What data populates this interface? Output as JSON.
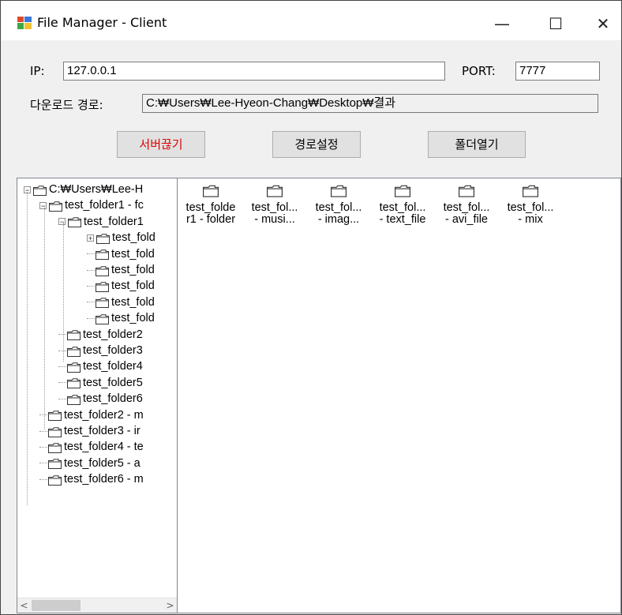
{
  "window": {
    "title": "File Manager - Client",
    "min_glyph": "—",
    "max_glyph": "☐",
    "close_glyph": "✕"
  },
  "connection": {
    "ip_label": "IP:",
    "ip_value": "127.0.0.1",
    "port_label": "PORT:",
    "port_value": "7777",
    "path_label": "다운로드 경로:",
    "path_value": "C:₩Users₩Lee-Hyeon-Chang₩Desktop₩결과"
  },
  "buttons": {
    "disconnect": "서버끊기",
    "set_path": "경로설정",
    "open_folder": "폴더열기"
  },
  "tree": [
    {
      "label": "C:₩Users₩Lee-H",
      "depth": 0,
      "exp": "⊟"
    },
    {
      "label": "test_folder1 - fc",
      "depth": 1,
      "exp": "⊟"
    },
    {
      "label": "test_folder1",
      "depth": 2,
      "exp": "⊟"
    },
    {
      "label": "test_fold",
      "depth": 3,
      "exp": "⊞"
    },
    {
      "label": "test_fold",
      "depth": 3
    },
    {
      "label": "test_fold",
      "depth": 3
    },
    {
      "label": "test_fold",
      "depth": 3
    },
    {
      "label": "test_fold",
      "depth": 3
    },
    {
      "label": "test_fold",
      "depth": 3
    },
    {
      "label": "test_folder2",
      "depth": 2
    },
    {
      "label": "test_folder3",
      "depth": 2
    },
    {
      "label": "test_folder4",
      "depth": 2
    },
    {
      "label": "test_folder5",
      "depth": 2
    },
    {
      "label": "test_folder6",
      "depth": 2
    },
    {
      "label": "test_folder2 - m",
      "depth": 1
    },
    {
      "label": "test_folder3 - ir",
      "depth": 1
    },
    {
      "label": "test_folder4 - te",
      "depth": 1
    },
    {
      "label": "test_folder5 - a",
      "depth": 1
    },
    {
      "label": "test_folder6 - m",
      "depth": 1
    }
  ],
  "scroll": {
    "left": "<",
    "right": ">"
  },
  "list_items": [
    {
      "line1": "test_folde",
      "line2": "r1 - folder"
    },
    {
      "line1": "test_fol...",
      "line2": "- musi..."
    },
    {
      "line1": "test_fol...",
      "line2": "- imag..."
    },
    {
      "line1": "test_fol...",
      "line2": "- text_file"
    },
    {
      "line1": "test_fol...",
      "line2": "- avi_file"
    },
    {
      "line1": "test_fol...",
      "line2": "- mix"
    }
  ]
}
